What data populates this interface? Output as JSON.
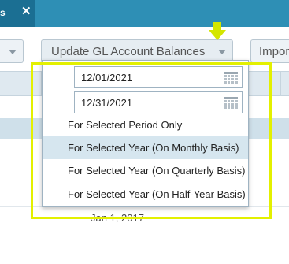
{
  "tab": {
    "label": "s",
    "close": "✕"
  },
  "toolbar": {
    "update_button": "Update GL Account Balances",
    "import_button": "Impor"
  },
  "dropdown": {
    "from_date": "12/01/2021",
    "to_date": "12/31/2021",
    "options": [
      "For Selected Period Only",
      "For Selected Year (On Monthly Basis)",
      "For Selected Year (On Quarterly Basis)",
      "For Selected Year (On Half-Year Basis)"
    ],
    "selected_option": 1
  },
  "grid": {
    "row_date": "Jan 1, 2017"
  },
  "colors": {
    "highlight": "#e3f000",
    "header_bar": "#2e8fb5",
    "selected_row": "#d6e6ef"
  }
}
